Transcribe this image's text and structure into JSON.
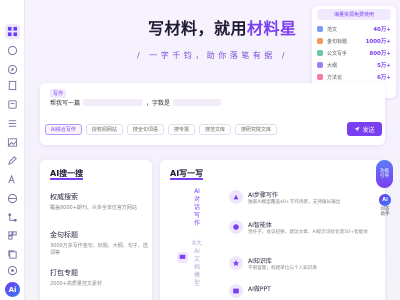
{
  "hero": {
    "title_prefix": "写材料，就用",
    "brand": "材料星",
    "subtitle": "/ 一字千钧，助你落笔有据 /"
  },
  "promo": {
    "title": "海量资源免费使用",
    "items": [
      {
        "label": "范文",
        "value": "40万+",
        "color": "#7b9cf6"
      },
      {
        "label": "金句标题",
        "value": "1000万+",
        "color": "#f29a5e"
      },
      {
        "label": "公文写手",
        "value": "800万+",
        "color": "#6cc5a0"
      },
      {
        "label": "大纲",
        "value": "5万+",
        "color": "#a27cf2"
      },
      {
        "label": "方法论",
        "value": "6万+",
        "color": "#f27ca6"
      }
    ]
  },
  "composer": {
    "tag": "写作",
    "prompt_prefix": "帮我写一篇",
    "prompt_mid": "，字数是",
    "chips": [
      "AI综合写作",
      "授权阅网站",
      "搜全句词语",
      "搜专报",
      "搜范文库",
      "搜研究院文库"
    ],
    "send_label": "发送"
  },
  "left_panel": {
    "title": "AI搜一搜",
    "items": [
      {
        "title": "权威搜索",
        "desc": "覆盖8000+期刊、众多全单位官方网站"
      },
      {
        "title": "金句标题",
        "desc": "3000万多写作金句、标题、大纲、句子、选词等"
      },
      {
        "title": "打包专题",
        "desc": "2000+高质量范文素材"
      }
    ]
  },
  "right_panel": {
    "title": "AI写一写",
    "vertical_text": "AI对话写作",
    "vertical_text_muted": "8大AI文档模型",
    "items": [
      {
        "title": "AI步骤写作",
        "desc": "独家AI模型覆盖40+写作场景，支持跟长输出"
      },
      {
        "title": "AI智能体",
        "desc": "党纤子、会议纪要、建议文章、AI提示词优化等50+智能体"
      },
      {
        "title": "AI知识库",
        "desc": "不限容量，构建单位与个人知识库"
      },
      {
        "title": "AI做PPT",
        "desc": ""
      }
    ]
  },
  "floats": {
    "feature_label_1": "功能",
    "feature_label_2": "引导",
    "assistant_label_1": "问答",
    "assistant_label_2": "助手",
    "assistant_logo": "Ai"
  },
  "rail": {
    "logo": "Ai",
    "icons": [
      "grid-icon",
      "chat-icon",
      "compass-icon",
      "document-icon",
      "book-icon",
      "list-icon",
      "image-icon",
      "pen-icon",
      "text-icon",
      "globe-icon",
      "flow-icon",
      "grid-small-icon",
      "copy-icon",
      "support-icon"
    ]
  }
}
